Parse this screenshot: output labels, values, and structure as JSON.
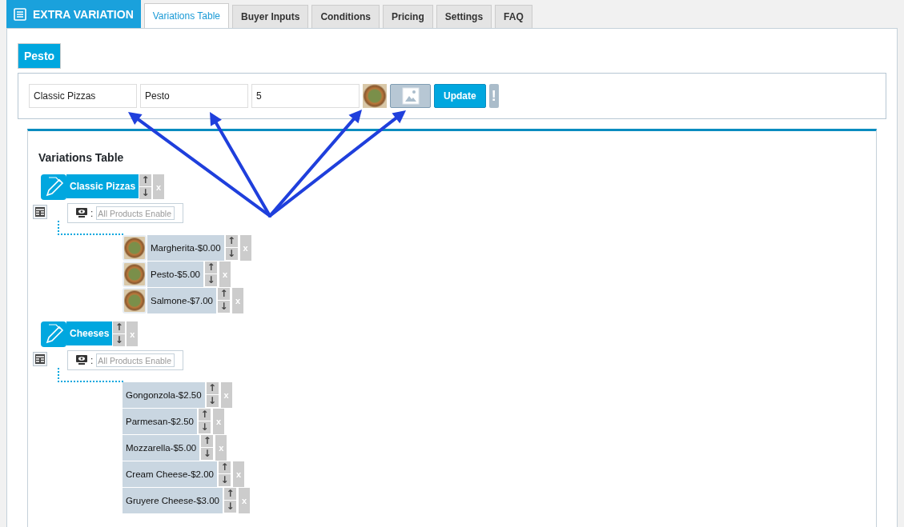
{
  "header": {
    "title": "EXTRA VARIATION"
  },
  "tabs": [
    {
      "label": "Variations Table",
      "selected": true
    },
    {
      "label": "Buyer Inputs",
      "selected": false
    },
    {
      "label": "Conditions",
      "selected": false
    },
    {
      "label": "Pricing",
      "selected": false
    },
    {
      "label": "Settings",
      "selected": false
    },
    {
      "label": "FAQ",
      "selected": false
    }
  ],
  "editor": {
    "title": "Pesto",
    "fields": [
      {
        "value": "Classic Pizzas"
      },
      {
        "value": "Pesto"
      },
      {
        "value": "5"
      }
    ],
    "update_button": "Update",
    "info_button": "!"
  },
  "variations": {
    "title": "Variations Table",
    "groups": [
      {
        "name": "Classic Pizzas",
        "up": "↑",
        "down": "↓",
        "remove": "x",
        "separator": ":",
        "enable_placeholder": "All Products Enable",
        "items": [
          {
            "label": "Margherita-$0.00",
            "kind": "photo",
            "up": "↑",
            "down": "↓",
            "remove": "x"
          },
          {
            "label": "Pesto-$5.00",
            "kind": "photo",
            "up": "↑",
            "down": "↓",
            "remove": "x"
          },
          {
            "label": "Salmone-$7.00",
            "kind": "photo",
            "up": "↑",
            "down": "↓",
            "remove": "x"
          }
        ]
      },
      {
        "name": "Cheeses",
        "up": "↑",
        "down": "↓",
        "remove": "x",
        "separator": ":",
        "enable_placeholder": "All Products Enable",
        "items": [
          {
            "label": "Gongonzola-$2.50",
            "kind": "plain",
            "up": "↑",
            "down": "↓",
            "remove": "x"
          },
          {
            "label": "Parmesan-$2.50",
            "kind": "plain",
            "up": "↑",
            "down": "↓",
            "remove": "x"
          },
          {
            "label": "Mozzarella-$5.00",
            "kind": "plain",
            "up": "↑",
            "down": "↓",
            "remove": "x"
          },
          {
            "label": "Cream Cheese-$2.00",
            "kind": "plain",
            "up": "↑",
            "down": "↓",
            "remove": "x"
          },
          {
            "label": "Gruyere Cheese-$3.00",
            "kind": "plain",
            "up": "↑",
            "down": "↓",
            "remove": "x"
          }
        ]
      }
    ]
  }
}
